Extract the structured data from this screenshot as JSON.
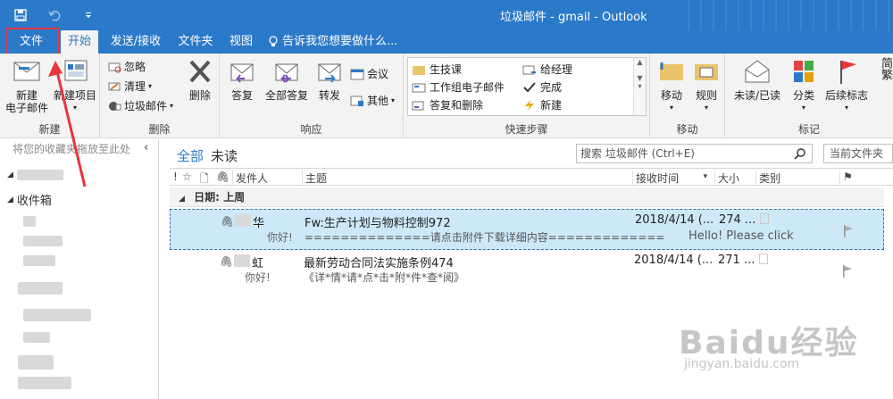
{
  "window": {
    "title": "垃圾邮件 - gmail - Outlook"
  },
  "quick_access": [
    "save-icon",
    "undo-icon",
    "customize-icon"
  ],
  "tabs": [
    {
      "label": "文件"
    },
    {
      "label": "开始"
    },
    {
      "label": "发送/接收"
    },
    {
      "label": "文件夹"
    },
    {
      "label": "视图"
    },
    {
      "label": "告诉我您想要做什么..."
    }
  ],
  "ribbon": {
    "new_group": {
      "label": "新建",
      "new_email": "新建\n电子邮件",
      "new_items": "新建项目"
    },
    "delete_group": {
      "label": "删除",
      "ignore": "忽略",
      "clean": "清理",
      "junk": "垃圾邮件",
      "delete": "删除"
    },
    "respond_group": {
      "label": "响应",
      "reply": "答复",
      "reply_all": "全部答复",
      "forward": "转发",
      "meeting": "会议",
      "more": "其他"
    },
    "quick_steps": {
      "label": "快速步骤",
      "items": [
        "生技课",
        "给经理",
        "工作组电子邮件",
        "完成",
        "答复和删除",
        "新建"
      ]
    },
    "move_group": {
      "label": "移动",
      "move": "移动",
      "rules": "规则"
    },
    "tags_group": {
      "label": "标记",
      "unread_read": "未读/已读",
      "categorize": "分类",
      "followup": "后续标志",
      "extra": "简繁"
    }
  },
  "leftnav": {
    "fav_hint": "将您的收藏夹拖放至此处",
    "inbox_label": "收件箱"
  },
  "list": {
    "filter_all": "全部",
    "filter_unread": "未读",
    "search_placeholder": "搜索 垃圾邮件 (Ctrl+E)",
    "scope": "当前文件夹",
    "columns": {
      "sender": "发件人",
      "subject": "主题",
      "received": "接收时间",
      "size": "大小",
      "category": "类别"
    },
    "group_header": "日期: 上周",
    "emails": [
      {
        "sender": "华",
        "preview_left": "你好!",
        "subject": "Fw:生产计划与物料控制972",
        "preview": "==============请点击附件下载详细内容=============",
        "extra": "Hello! Please click",
        "date": "2018/4/14 (...",
        "size": "274 ..."
      },
      {
        "sender": "虹",
        "preview_left": "你好!",
        "subject": "最新劳动合同法实施条例474",
        "preview": "《详*情*请*点*击*附*件*查*阅》",
        "extra": "",
        "date": "2018/4/14 (...",
        "size": "271 ..."
      }
    ]
  },
  "watermark": {
    "logo": "Baidu经验",
    "url": "jingyan.baidu.com"
  },
  "colors": {
    "accent": "#2b79c9",
    "highlight": "#e8343b",
    "selected_row": "#cde8f7"
  }
}
